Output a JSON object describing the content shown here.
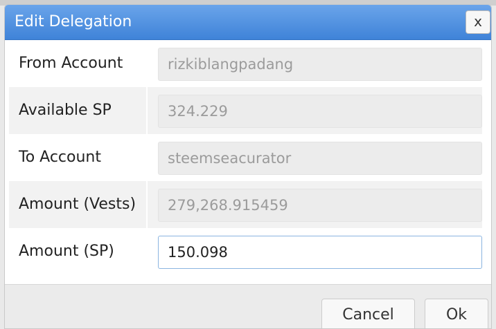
{
  "dialog": {
    "title": "Edit Delegation",
    "close_label": "x"
  },
  "form": {
    "rows": [
      {
        "label": "From Account",
        "value": "rizkiblangpadang"
      },
      {
        "label": "Available SP",
        "value": "324.229"
      },
      {
        "label": "To Account",
        "value": "steemseacurator"
      },
      {
        "label": "Amount (Vests)",
        "value": "279,268.915459"
      },
      {
        "label": "Amount (SP)",
        "value": "150.098"
      }
    ]
  },
  "footer": {
    "cancel_label": "Cancel",
    "ok_label": "Ok"
  }
}
